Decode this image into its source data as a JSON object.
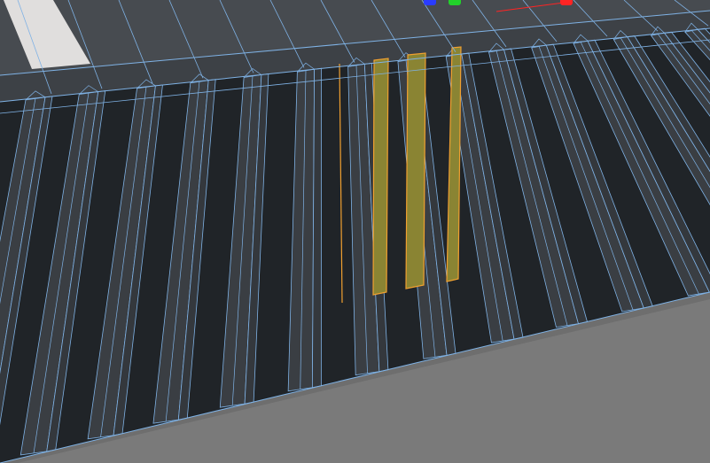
{
  "viewport": {
    "mode": "edit",
    "colors": {
      "background": "#6e6e6e",
      "floor": "#7a7a7a",
      "mesh_surface": "#3d4146",
      "mesh_top": "#474b50",
      "slot_interior": "#202428",
      "fin_face": "#3a3e43",
      "fin_side": "#34383d",
      "wire": "#7fb2e5",
      "highlight_strip": "#e0dedd",
      "selection_fill": "#8a8433",
      "selection_edge": "#f0a030"
    }
  },
  "mesh": {
    "name": "grille",
    "fin_count": 17,
    "selected_faces": 3
  },
  "gizmo": {
    "axes": [
      {
        "name": "z",
        "color": "#2a3cff",
        "icon": "blue-axis-handle-icon"
      },
      {
        "name": "y",
        "color": "#22d22a",
        "icon": "green-axis-handle-icon"
      },
      {
        "name": "x",
        "color": "#ff2424",
        "icon": "red-axis-handle-icon"
      }
    ]
  }
}
